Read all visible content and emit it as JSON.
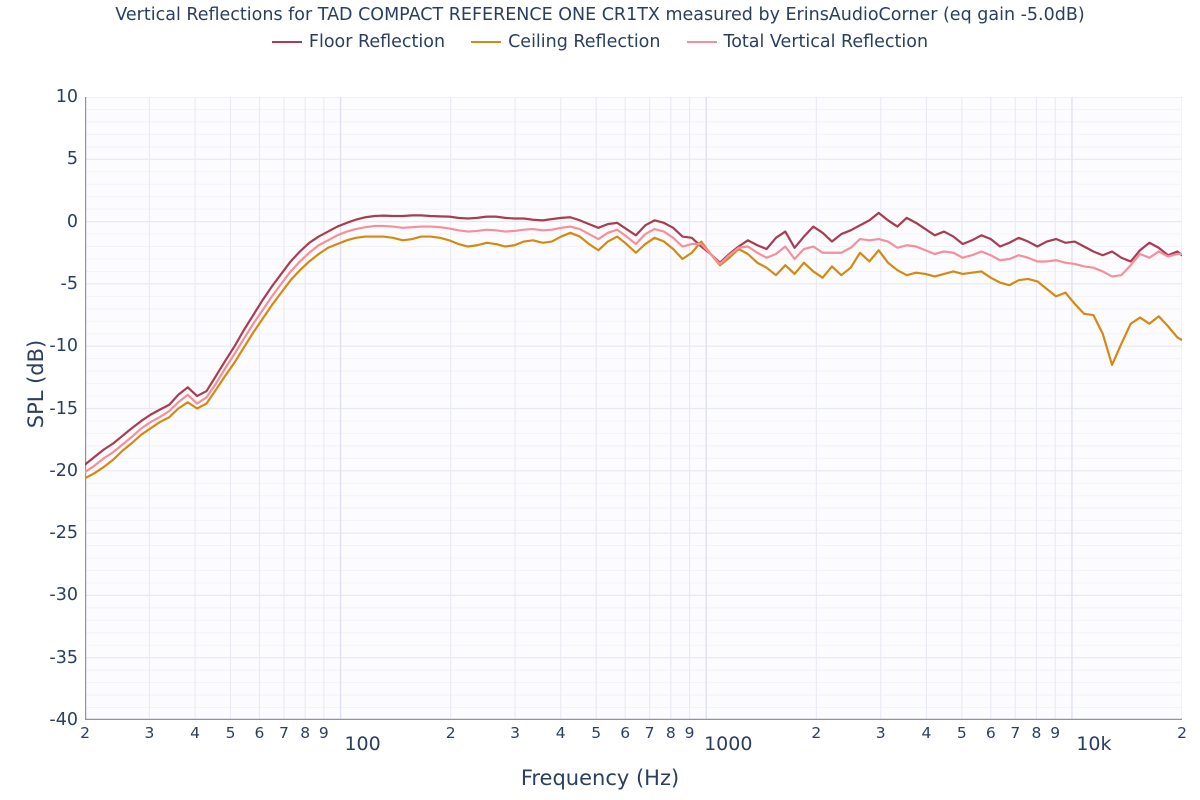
{
  "chart_data": {
    "type": "line",
    "title": "Vertical Reflections for TAD COMPACT REFERENCE ONE CR1TX measured by ErinsAudioCorner (eq gain -5.0dB)",
    "xlabel": "Frequency (Hz)",
    "ylabel": "SPL (dB)",
    "xscale": "log",
    "xlim": [
      20,
      20000
    ],
    "ylim": [
      -40,
      10
    ],
    "grid": true,
    "legend_position": "top-center",
    "y_ticks": [
      10,
      5,
      0,
      -5,
      -10,
      -15,
      -20,
      -25,
      -30,
      -35,
      -40
    ],
    "y_tick_labels": [
      "10",
      "5",
      "0",
      "-5",
      "-10",
      "-15",
      "-20",
      "-25",
      "-30",
      "-35",
      "-40"
    ],
    "y_minor_step": 1,
    "x_minor_ticks": [
      {
        "value": 20,
        "label": "2"
      },
      {
        "value": 30,
        "label": "3"
      },
      {
        "value": 40,
        "label": "4"
      },
      {
        "value": 50,
        "label": "5"
      },
      {
        "value": 60,
        "label": "6"
      },
      {
        "value": 70,
        "label": "7"
      },
      {
        "value": 80,
        "label": "8"
      },
      {
        "value": 90,
        "label": "9"
      },
      {
        "value": 200,
        "label": "2"
      },
      {
        "value": 300,
        "label": "3"
      },
      {
        "value": 400,
        "label": "4"
      },
      {
        "value": 500,
        "label": "5"
      },
      {
        "value": 600,
        "label": "6"
      },
      {
        "value": 700,
        "label": "7"
      },
      {
        "value": 800,
        "label": "8"
      },
      {
        "value": 900,
        "label": "9"
      },
      {
        "value": 2000,
        "label": "2"
      },
      {
        "value": 3000,
        "label": "3"
      },
      {
        "value": 4000,
        "label": "4"
      },
      {
        "value": 5000,
        "label": "5"
      },
      {
        "value": 6000,
        "label": "6"
      },
      {
        "value": 7000,
        "label": "7"
      },
      {
        "value": 8000,
        "label": "8"
      },
      {
        "value": 9000,
        "label": "9"
      },
      {
        "value": 20000,
        "label": "2"
      }
    ],
    "x_major_ticks": [
      {
        "value": 100,
        "label": "100"
      },
      {
        "value": 1000,
        "label": "1000"
      },
      {
        "value": 10000,
        "label": "10k"
      }
    ],
    "colors": {
      "floor": "#a83c52",
      "ceiling": "#d68910",
      "total": "#f58f9b",
      "text": "#2a3f5f",
      "plot_background": "#fcfcfe",
      "paper_background": "#ffffff",
      "gridline": "#e8eaf2",
      "minor_gridline": "#f2f3f8"
    },
    "x": [
      20,
      21.2,
      22.5,
      23.9,
      25.3,
      26.8,
      28.5,
      30.2,
      32,
      34,
      36,
      38.2,
      40.5,
      43,
      45.6,
      48.3,
      51.3,
      54.4,
      57.7,
      61.2,
      64.9,
      68.8,
      73,
      77.4,
      82.1,
      87.1,
      92.4,
      98,
      104,
      110,
      117,
      124,
      131,
      139,
      148,
      157,
      166,
      176,
      187,
      198,
      210,
      223,
      236,
      251,
      266,
      282,
      299,
      317,
      336,
      357,
      378,
      401,
      425,
      451,
      478,
      507,
      538,
      571,
      605,
      642,
      681,
      722,
      766,
      812,
      861,
      913,
      969,
      1028,
      1090,
      1156,
      1226,
      1300,
      1379,
      1462,
      1551,
      1645,
      1744,
      1850,
      1962,
      2081,
      2207,
      2341,
      2483,
      2633,
      2793,
      2962,
      3141,
      3332,
      3533,
      3747,
      3974,
      4215,
      4470,
      4741,
      5028,
      5332,
      5655,
      5997,
      6360,
      6745,
      7153,
      7586,
      8045,
      8532,
      9049,
      9597,
      10178,
      10794,
      11447,
      12140,
      12875,
      13654,
      14481,
      15357,
      16287,
      17272,
      18318,
      19427,
      20000
    ],
    "series": [
      {
        "name": "Floor Reflection",
        "color": "#a83c52",
        "values": [
          -19.5,
          -18.9,
          -18.3,
          -17.8,
          -17.2,
          -16.6,
          -16.0,
          -15.5,
          -15.1,
          -14.7,
          -13.9,
          -13.3,
          -14.0,
          -13.6,
          -12.4,
          -11.2,
          -10.0,
          -8.7,
          -7.5,
          -6.3,
          -5.2,
          -4.2,
          -3.2,
          -2.4,
          -1.7,
          -1.2,
          -0.8,
          -0.4,
          -0.1,
          0.15,
          0.35,
          0.45,
          0.48,
          0.45,
          0.45,
          0.5,
          0.5,
          0.45,
          0.42,
          0.4,
          0.3,
          0.25,
          0.3,
          0.4,
          0.4,
          0.3,
          0.25,
          0.25,
          0.15,
          0.1,
          0.2,
          0.3,
          0.35,
          0.1,
          -0.2,
          -0.5,
          -0.2,
          -0.1,
          -0.6,
          -1.1,
          -0.3,
          0.1,
          -0.1,
          -0.5,
          -1.2,
          -1.3,
          -2.0,
          -2.6,
          -3.3,
          -2.6,
          -2.0,
          -1.5,
          -1.9,
          -2.2,
          -1.3,
          -0.8,
          -2.1,
          -1.2,
          -0.4,
          -0.9,
          -1.6,
          -1.0,
          -0.7,
          -0.3,
          0.1,
          0.7,
          0.1,
          -0.4,
          0.3,
          -0.1,
          -0.6,
          -1.1,
          -0.8,
          -1.2,
          -1.8,
          -1.5,
          -1.1,
          -1.4,
          -2.0,
          -1.7,
          -1.3,
          -1.6,
          -2.0,
          -1.6,
          -1.4,
          -1.7,
          -1.6,
          -2.0,
          -2.4,
          -2.7,
          -2.4,
          -2.9,
          -3.2,
          -2.3,
          -1.7,
          -2.1,
          -2.7,
          -2.4,
          -2.7,
          -3.1,
          -3.3,
          -3.5,
          -3.8
        ]
      },
      {
        "name": "Ceiling Reflection",
        "color": "#d68910",
        "values": [
          -20.6,
          -20.2,
          -19.7,
          -19.1,
          -18.4,
          -17.8,
          -17.1,
          -16.6,
          -16.1,
          -15.7,
          -15.0,
          -14.5,
          -15.0,
          -14.6,
          -13.5,
          -12.4,
          -11.3,
          -10.1,
          -8.9,
          -7.8,
          -6.7,
          -5.7,
          -4.7,
          -3.9,
          -3.2,
          -2.6,
          -2.1,
          -1.8,
          -1.5,
          -1.3,
          -1.2,
          -1.2,
          -1.2,
          -1.3,
          -1.5,
          -1.4,
          -1.2,
          -1.2,
          -1.3,
          -1.5,
          -1.8,
          -2.0,
          -1.9,
          -1.7,
          -1.8,
          -2.0,
          -1.9,
          -1.6,
          -1.5,
          -1.7,
          -1.6,
          -1.2,
          -0.9,
          -1.2,
          -1.8,
          -2.3,
          -1.6,
          -1.2,
          -1.8,
          -2.5,
          -1.8,
          -1.3,
          -1.6,
          -2.2,
          -3.0,
          -2.5,
          -1.6,
          -2.6,
          -3.5,
          -2.9,
          -2.2,
          -2.6,
          -3.3,
          -3.7,
          -4.3,
          -3.5,
          -4.2,
          -3.3,
          -4.0,
          -4.5,
          -3.6,
          -4.3,
          -3.7,
          -2.5,
          -3.2,
          -2.3,
          -3.3,
          -3.9,
          -4.3,
          -4.1,
          -4.2,
          -4.4,
          -4.2,
          -4.0,
          -4.2,
          -4.1,
          -4.0,
          -4.5,
          -4.9,
          -5.1,
          -4.7,
          -4.6,
          -4.8,
          -5.4,
          -6.0,
          -5.7,
          -6.6,
          -7.4,
          -7.5,
          -9.0,
          -11.5,
          -9.8,
          -8.2,
          -7.7,
          -8.2,
          -7.6,
          -8.4,
          -9.3,
          -9.5,
          -11.0
        ]
      },
      {
        "name": "Total Vertical Reflection",
        "color": "#f58f9b",
        "values": [
          -20.1,
          -19.6,
          -19.0,
          -18.5,
          -17.9,
          -17.3,
          -16.6,
          -16.1,
          -15.7,
          -15.2,
          -14.5,
          -13.9,
          -14.6,
          -14.1,
          -13.0,
          -11.8,
          -10.6,
          -9.4,
          -8.2,
          -7.1,
          -6.0,
          -5.0,
          -4.0,
          -3.2,
          -2.5,
          -1.9,
          -1.5,
          -1.1,
          -0.8,
          -0.6,
          -0.45,
          -0.35,
          -0.35,
          -0.4,
          -0.5,
          -0.45,
          -0.4,
          -0.4,
          -0.45,
          -0.55,
          -0.7,
          -0.8,
          -0.75,
          -0.65,
          -0.7,
          -0.8,
          -0.75,
          -0.65,
          -0.6,
          -0.7,
          -0.65,
          -0.5,
          -0.4,
          -0.6,
          -1.0,
          -1.4,
          -0.9,
          -0.65,
          -1.2,
          -1.8,
          -1.0,
          -0.6,
          -0.8,
          -1.3,
          -2.0,
          -1.8,
          -1.8,
          -2.6,
          -3.4,
          -2.7,
          -2.1,
          -2.0,
          -2.5,
          -2.9,
          -2.6,
          -2.0,
          -3.0,
          -2.2,
          -2.0,
          -2.5,
          -2.5,
          -2.5,
          -2.1,
          -1.4,
          -1.5,
          -1.4,
          -1.6,
          -2.1,
          -1.9,
          -2.0,
          -2.3,
          -2.6,
          -2.4,
          -2.5,
          -2.9,
          -2.7,
          -2.4,
          -2.7,
          -3.1,
          -3.0,
          -2.7,
          -2.9,
          -3.2,
          -3.2,
          -3.1,
          -3.3,
          -3.4,
          -3.6,
          -3.7,
          -4.0,
          -4.4,
          -4.3,
          -3.5,
          -2.6,
          -2.9,
          -2.4,
          -2.8,
          -2.6,
          -2.6,
          -2.6
        ]
      }
    ]
  },
  "legend": {
    "items": [
      {
        "label": "Floor Reflection",
        "color": "#a83c52"
      },
      {
        "label": "Ceiling Reflection",
        "color": "#d68910"
      },
      {
        "label": "Total Vertical Reflection",
        "color": "#f58f9b"
      }
    ]
  }
}
